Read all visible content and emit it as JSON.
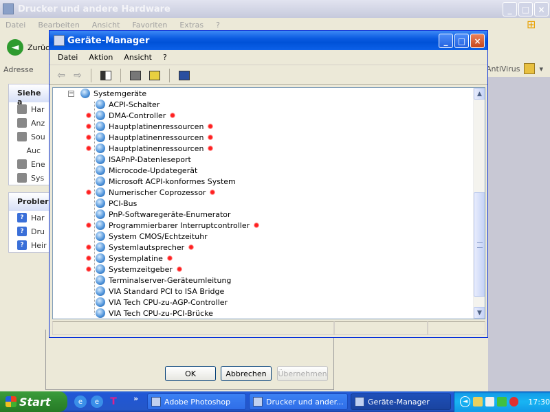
{
  "bg_window": {
    "title": "Drucker und andere Hardware",
    "menu": [
      "Datei",
      "Bearbeiten",
      "Ansicht",
      "Favoriten",
      "Extras",
      "?"
    ],
    "back_label": "Zurück",
    "address_label": "Adresse",
    "antivirus_label": "AntiVirus",
    "see_also": {
      "head": "Siehe a",
      "items": [
        "Har",
        "Anz",
        "Sou",
        "Auc",
        "Ene",
        "Sys"
      ]
    },
    "problems": {
      "head": "Probler",
      "items": [
        "Har",
        "Dru",
        "Heir"
      ]
    }
  },
  "dialog": {
    "ok_label": "OK",
    "cancel_label": "Abbrechen",
    "apply_label": "Übernehmen"
  },
  "device_manager": {
    "title": "Geräte-Manager",
    "menu": [
      "Datei",
      "Aktion",
      "Ansicht",
      "?"
    ],
    "category": "Systemgeräte",
    "expander": "−",
    "devices": [
      {
        "label": "ACPI-Schalter",
        "flag": false
      },
      {
        "label": "DMA-Controller",
        "flag": true
      },
      {
        "label": "Hauptplatinenressourcen",
        "flag": true
      },
      {
        "label": "Hauptplatinenressourcen",
        "flag": true
      },
      {
        "label": "Hauptplatinenressourcen",
        "flag": true
      },
      {
        "label": "ISAPnP-Datenleseport",
        "flag": false
      },
      {
        "label": "Microcode-Updategerät",
        "flag": false
      },
      {
        "label": "Microsoft ACPI-konformes System",
        "flag": false
      },
      {
        "label": "Numerischer Coprozessor",
        "flag": true
      },
      {
        "label": "PCI-Bus",
        "flag": false
      },
      {
        "label": "PnP-Softwaregeräte-Enumerator",
        "flag": false
      },
      {
        "label": "Programmierbarer Interruptcontroller",
        "flag": true
      },
      {
        "label": "System CMOS/Echtzeituhr",
        "flag": false
      },
      {
        "label": "Systemlautsprecher",
        "flag": true
      },
      {
        "label": "Systemplatine",
        "flag": true
      },
      {
        "label": "Systemzeitgeber",
        "flag": true
      },
      {
        "label": "Terminalserver-Geräteumleitung",
        "flag": false
      },
      {
        "label": "VIA Standard PCI to ISA Bridge",
        "flag": false
      },
      {
        "label": "VIA Tech CPU-zu-AGP-Controller",
        "flag": false
      },
      {
        "label": "VIA Tech CPU-zu-PCI-Brücke",
        "flag": false
      }
    ],
    "scroll_up": "▲",
    "scroll_down": "▼"
  },
  "taskbar": {
    "start_label": "Start",
    "quick_more": "»",
    "tasks": [
      {
        "label": "Adobe Photoshop",
        "active": false
      },
      {
        "label": "Drucker und ander...",
        "active": false
      },
      {
        "label": "Geräte-Manager",
        "active": true
      }
    ],
    "clock": "17:30"
  },
  "icons": {
    "back": "arrow-left-icon",
    "forward": "arrow-right-icon",
    "device": "device-icon",
    "marker": "red-marker"
  },
  "colors": {
    "xp_blue": "#0052d8",
    "start_green": "#2f8a2f",
    "marker_red": "#ff2020"
  }
}
